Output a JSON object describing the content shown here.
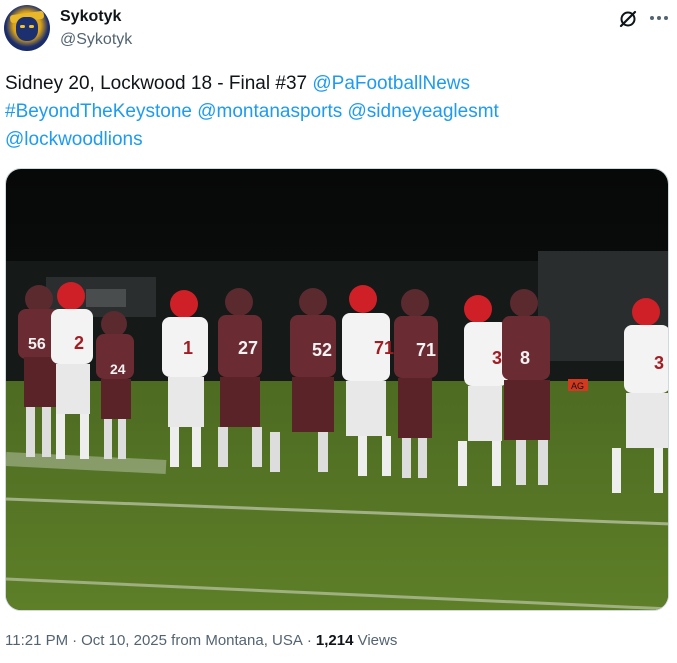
{
  "author": {
    "display_name": "Sykotyk",
    "handle": "@Sykotyk",
    "avatar_icon": "helmet-logo-avatar"
  },
  "icons": {
    "grok": "grok-icon",
    "more": "more-icon"
  },
  "tweet": {
    "text_plain": "Sidney 20, Lockwood 18 - Final #37 ",
    "mentions": [
      "@PaFootballNews",
      "#BeyondTheKeystone",
      "@montanasports",
      "@sidneyeaglesmt",
      "@lockwoodlions"
    ],
    "link_color": "#1d9bf0"
  },
  "media": {
    "alt": "Football players from Sidney and Lockwood shaking hands on the field at night",
    "jerseys": [
      "56",
      "2",
      "24",
      "1",
      "27",
      "52",
      "71",
      "71",
      "3",
      "8",
      "3"
    ],
    "sign_text": "AG"
  },
  "meta": {
    "time": "11:21 PM",
    "date": "Oct 10, 2025",
    "location": "from Montana, USA",
    "views_count": "1,214",
    "views_label": "Views",
    "separator": "·"
  }
}
